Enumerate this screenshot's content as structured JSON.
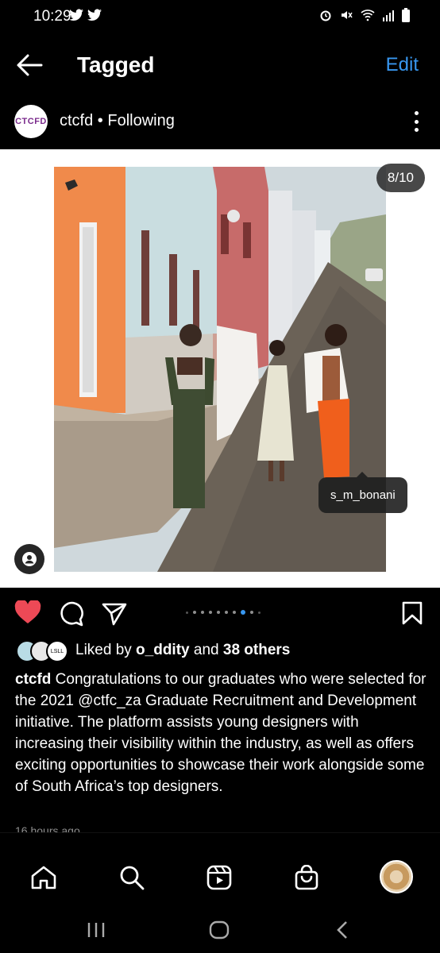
{
  "status_bar": {
    "time": "10:29",
    "icons": [
      "twitter-icon",
      "twitter-icon",
      "alarm-icon",
      "mute-icon",
      "wifi-icon",
      "signal-icon",
      "battery-icon"
    ]
  },
  "header": {
    "title": "Tagged",
    "edit_label": "Edit"
  },
  "profile": {
    "avatar_text": "CTCFD",
    "name_line": "ctcfd • Following"
  },
  "post": {
    "counter": "8/10",
    "tag_username": "s_m_bonani",
    "carousel_dots": 10,
    "active_dot": 8
  },
  "likes": {
    "avatar_label": "LSLL",
    "prefix": "Liked by ",
    "user": "o_ddity",
    "middle": " and ",
    "others": "38 others"
  },
  "caption": {
    "username": "ctcfd",
    "text": " Congratulations to our graduates who were selected for the 2021 @ctfc_za Graduate  Recruitment and Development initiative. The platform assists young designers with increasing their visibility within the industry, as well as offers exciting opportunities to showcase their work alongside some of South Africa’s top designers."
  },
  "timestamp": "16 hours ago",
  "colors": {
    "accent": "#3897f0",
    "like": "#ed4956",
    "background": "#000000"
  }
}
